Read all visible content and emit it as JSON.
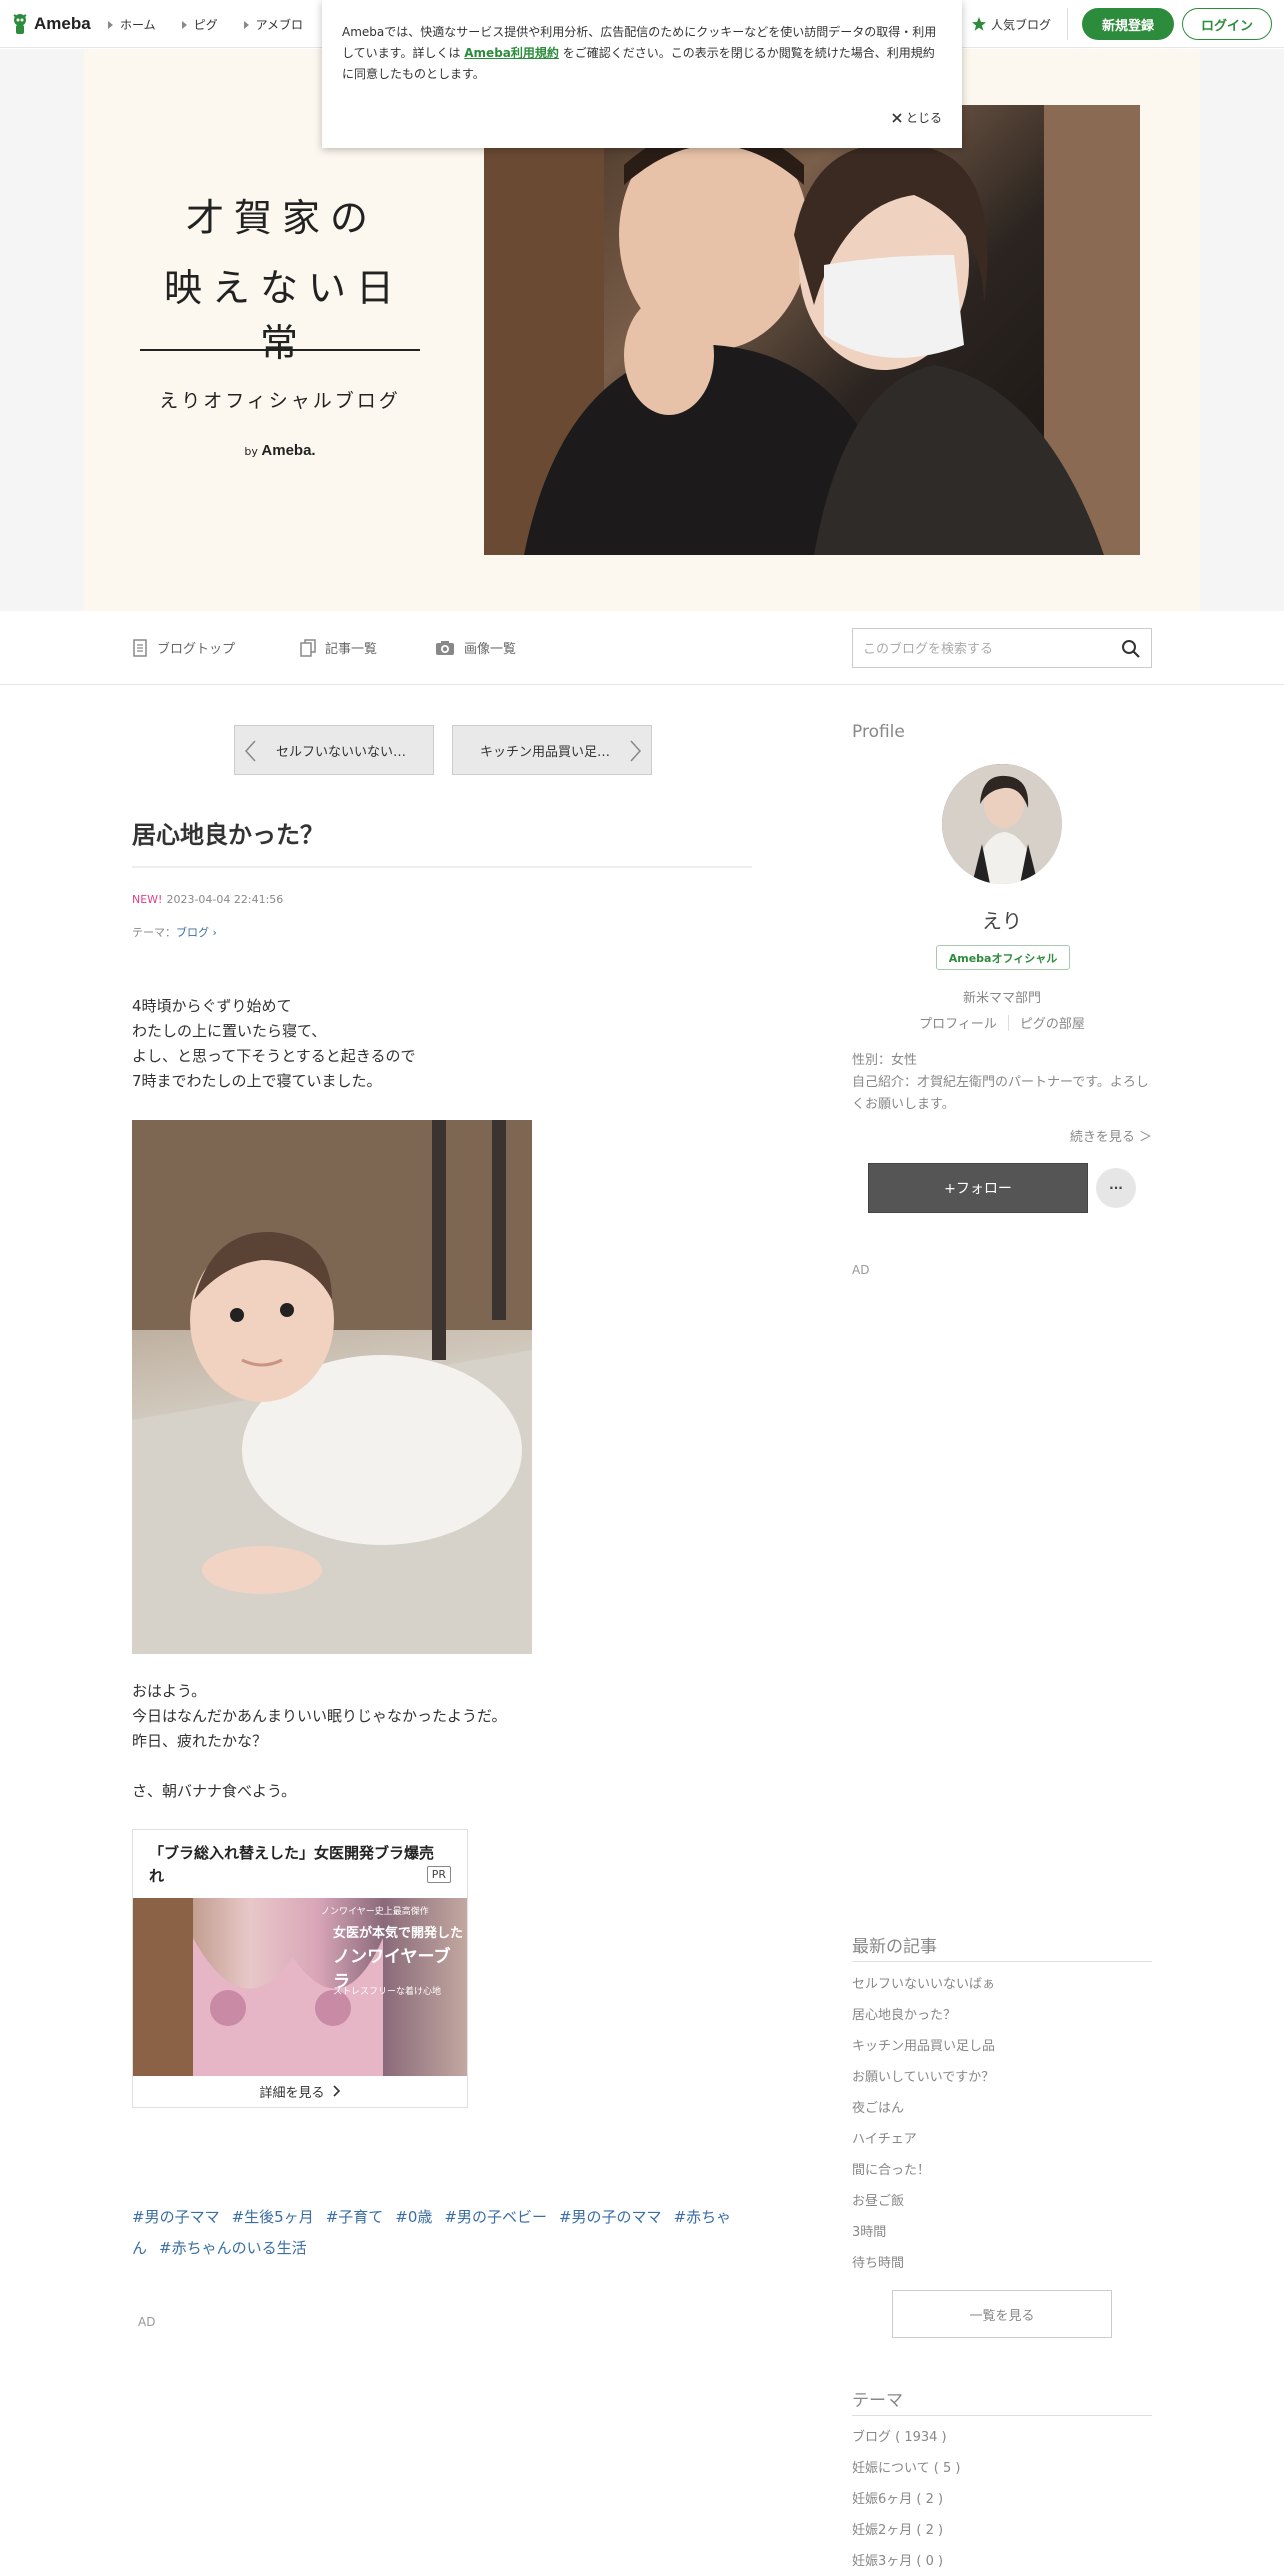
{
  "nav": {
    "logo": "Ameba",
    "links": [
      "ホーム",
      "ピグ",
      "アメブロ"
    ],
    "popular": "人気ブログ",
    "register": "新規登録",
    "login": "ログイン"
  },
  "cookie": {
    "text_before": "Amebaでは、快適なサービス提供や利用分析、広告配信のためにクッキーなどを使い訪問データの取得・利用しています。詳しくは ",
    "link": "Ameba利用規約",
    "text_after": " をご確認ください。この表示を閉じるか閲覧を続けた場合、利用規約に同意したものとします。",
    "close": "とじる"
  },
  "header": {
    "title_line1": "才賀家の",
    "title_line2": "映えない日常",
    "subtitle": "えりオフィシャルブログ",
    "by": "by",
    "brand": "Ameba."
  },
  "menu": {
    "top": "ブログトップ",
    "entries": "記事一覧",
    "images": "画像一覧",
    "search_placeholder": "このブログを検索する"
  },
  "pager": {
    "prev": "セルフいないいない…",
    "next": "キッチン用品買い足…"
  },
  "post": {
    "title": "居心地良かった？",
    "new_label": "NEW!",
    "datetime": "2023-04-04 22:41:56",
    "theme_label": "テーマ：",
    "theme": "ブログ",
    "para1": [
      "4時頃からぐずり始めて",
      "わたしの上に置いたら寝て、",
      "よし、と思って下そうとすると起きるので",
      "7時までわたしの上で寝ていました。"
    ],
    "para2": [
      "おはよう。",
      "今日はなんだかあんまりいい眠りじゃなかったようだ。",
      "昨日、疲れたかな？",
      "",
      "さ、朝バナナ食べよう。"
    ],
    "hashtags": [
      "#男の子ママ",
      "#生後5ヶ月",
      "#子育て",
      "#0歳",
      "#男の子ベビー",
      "#男の子のママ",
      "#赤ちゃん",
      "#赤ちゃんのいる生活"
    ],
    "ad_label": "AD"
  },
  "ad": {
    "title": "「ブラ総入れ替えした」女医開発ブラ爆売れ",
    "pr": "PR",
    "img_line1": "ノンワイヤー史上最高傑作",
    "img_line2": "女医が本気で開発した",
    "img_line3": "ノンワイヤーブラ",
    "img_line4": "ストレスフリーな着け心地",
    "more": "詳細を見る"
  },
  "sidebar": {
    "profile_heading": "Profile",
    "name": "えり",
    "official": "Amebaオフィシャル",
    "category": "新米ママ部門",
    "profile_link": "プロフィール",
    "pig_link": "ピグの部屋",
    "gender": "性別：女性",
    "intro": "自己紹介：才賀紀左衛門のパートナーです。よろしくお願いします。",
    "continue": "続きを見る ＞",
    "follow": "+フォロー",
    "more": "···",
    "ad_label": "AD",
    "latest_heading": "最新の記事",
    "latest": [
      "セルフいないいないばぁ",
      "居心地良かった？",
      "キッチン用品買い足し品",
      "お願いしていいですか？",
      "夜ごはん",
      "ハイチェア",
      "間に合った！",
      "お昼ご飯",
      "3時間",
      "待ち時間"
    ],
    "see_all": "一覧を見る",
    "theme_heading": "テーマ",
    "themes": [
      "ブログ ( 1934 )",
      "妊娠について ( 5 )",
      "妊娠6ヶ月 ( 2 )",
      "妊娠2ヶ月 ( 2 )",
      "妊娠3ヶ月 ( 0 )"
    ]
  },
  "colors": {
    "brand_green": "#2d8c3c",
    "link_blue": "#3a6ea5",
    "new_pink": "#e0408b",
    "header_bg": "#fdf8ef"
  }
}
